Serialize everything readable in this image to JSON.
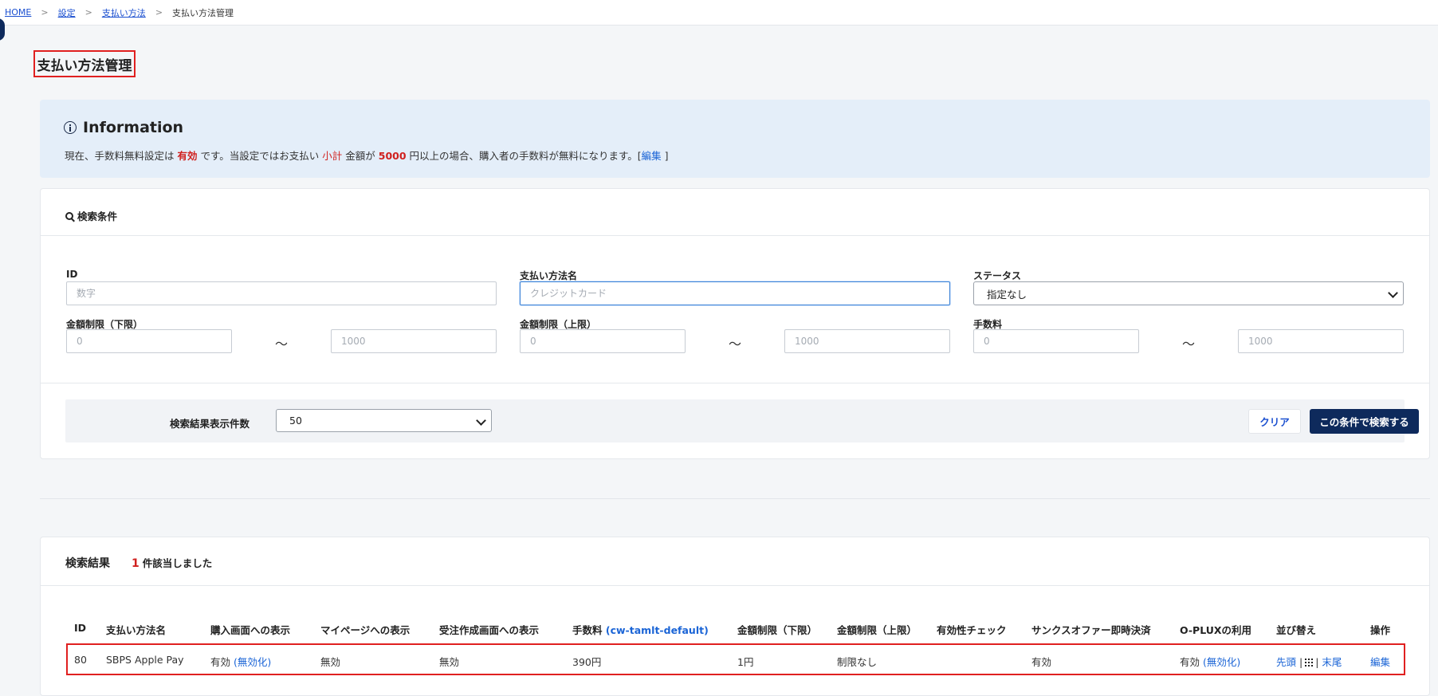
{
  "breadcrumb": {
    "home": "HOME",
    "settings": "設定",
    "payment": "支払い方法",
    "current": "支払い方法管理",
    "sep": ">"
  },
  "page": {
    "title": "支払い方法管理"
  },
  "info": {
    "title": "Information",
    "p1": "現在、手数料無料設定は",
    "status": "有効",
    "p2": "です。当設定ではお支払い",
    "subtotal": "小計",
    "p3": "金額が",
    "amount": "5000",
    "p4": "円以上の場合、購入者の手数料が無料になります。[",
    "edit": "編集",
    "p5": "]"
  },
  "search": {
    "title": "検索条件",
    "id_label": "ID",
    "id_placeholder": "数字",
    "name_label": "支払い方法名",
    "name_placeholder": "クレジットカード",
    "status_label": "ステータス",
    "status_value": "指定なし",
    "min_label": "金額制限（下限）",
    "max_label": "金額制限（上限）",
    "fee_label": "手数料",
    "range_from_placeholder": "0",
    "range_to_placeholder": "1000",
    "tilde": "～",
    "count_label": "検索結果表示件数",
    "count_value": "50",
    "clear": "クリア",
    "submit": "この条件で検索する"
  },
  "results": {
    "title": "検索結果",
    "count": "1",
    "suffix": "件該当しました",
    "headers": {
      "id": "ID",
      "name": "支払い方法名",
      "purchase": "購入画面への表示",
      "mypage": "マイページへの表示",
      "order": "受注作成画面への表示",
      "fee": "手数料",
      "fee_tag": "(cw-tamlt-default)",
      "min": "金額制限（下限）",
      "max": "金額制限（上限）",
      "check": "有効性チェック",
      "thanks": "サンクスオファー即時決済",
      "oplux": "O-PLUXの利用",
      "sort": "並び替え",
      "ops": "操作"
    },
    "row": {
      "id": "80",
      "name": "SBPS Apple Pay",
      "purchase": "有効",
      "purchase_link": "(無効化)",
      "mypage": "無効",
      "order": "無効",
      "fee": "390円",
      "min": "1円",
      "max": "制限なし",
      "check": "",
      "thanks": "有効",
      "oplux": "有効",
      "oplux_link": "(無効化)",
      "sort_first": "先頭",
      "sort_bar": "|",
      "sort_last": "末尾",
      "edit": "編集"
    }
  }
}
